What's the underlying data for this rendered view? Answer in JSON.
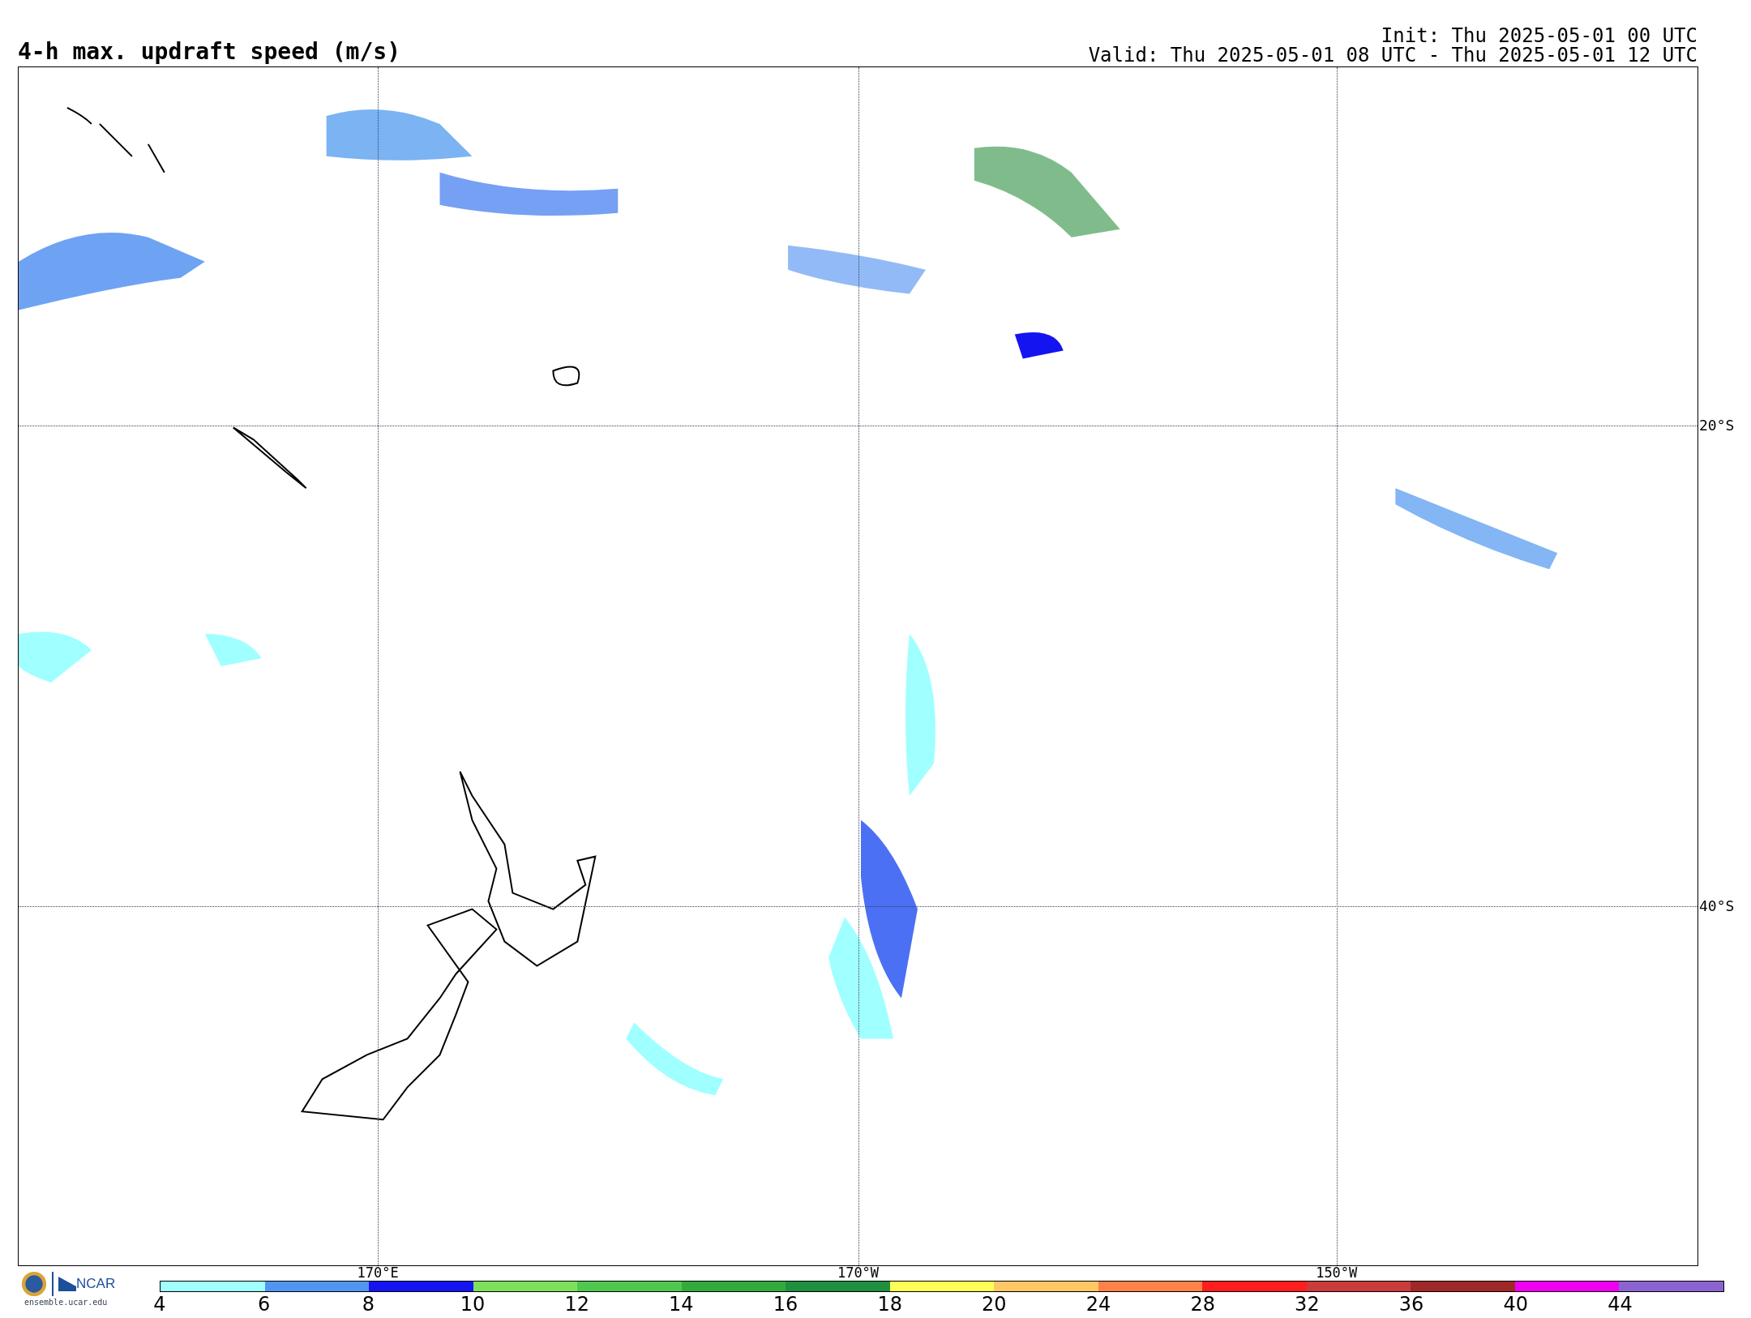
{
  "title": "4-h max. updraft speed (m/s)",
  "init": "Init: Thu 2025-05-01 00 UTC",
  "valid": "Valid: Thu 2025-05-01 08 UTC - Thu 2025-05-01 12 UTC",
  "map": {
    "latitude_labels": [
      "20°S",
      "40°S"
    ],
    "longitude_labels": [
      "170°E",
      "170°W",
      "150°W"
    ]
  },
  "logo": {
    "org": "NCAR",
    "site": "ensemble.ucar.edu"
  },
  "legend": {
    "bins": [
      {
        "label": "4",
        "color": "#a0ffff"
      },
      {
        "label": "6",
        "color": "#5096f0"
      },
      {
        "label": "8",
        "color": "#1414f0"
      },
      {
        "label": "10",
        "color": "#7ee05a"
      },
      {
        "label": "12",
        "color": "#50c850"
      },
      {
        "label": "14",
        "color": "#32aa3c"
      },
      {
        "label": "16",
        "color": "#1e9040"
      },
      {
        "label": "18",
        "color": "#ffff55"
      },
      {
        "label": "20",
        "color": "#ffc864"
      },
      {
        "label": "24",
        "color": "#ff8246"
      },
      {
        "label": "28",
        "color": "#ff1e1e"
      },
      {
        "label": "32",
        "color": "#c83c3c"
      },
      {
        "label": "36",
        "color": "#a02828"
      },
      {
        "label": "40",
        "color": "#f000f0"
      },
      {
        "label": "44",
        "color": "#8c64d2"
      }
    ]
  }
}
